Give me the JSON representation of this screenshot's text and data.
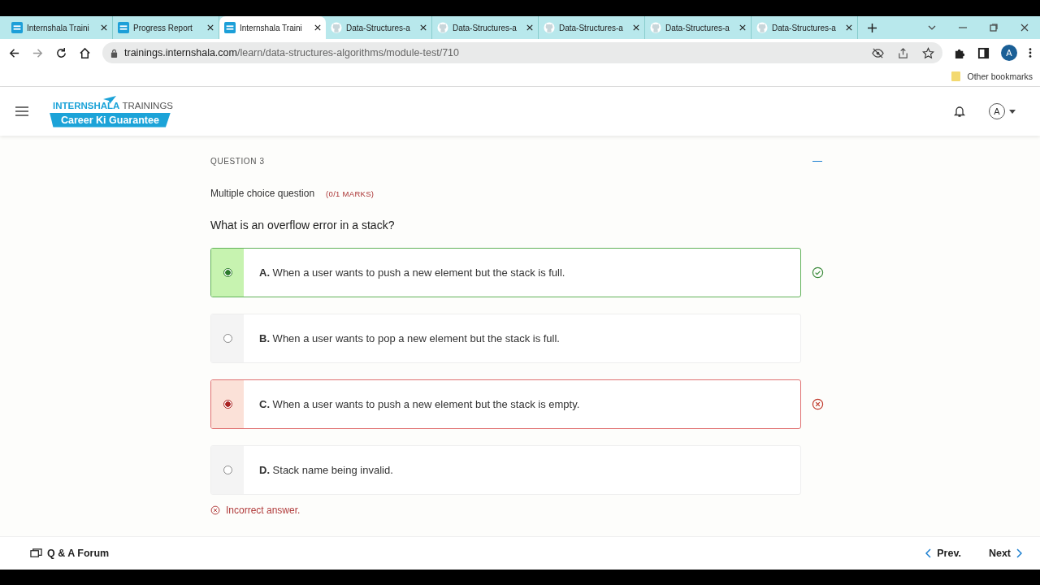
{
  "browser": {
    "tabs": [
      {
        "title": "Internshala Traini",
        "kind": "ist",
        "selected": false
      },
      {
        "title": "Progress Report",
        "kind": "ist",
        "selected": false
      },
      {
        "title": "Internshala Traini",
        "kind": "ist",
        "selected": true
      },
      {
        "title": "Data-Structures-a",
        "kind": "github",
        "selected": false
      },
      {
        "title": "Data-Structures-a",
        "kind": "github",
        "selected": false
      },
      {
        "title": "Data-Structures-a",
        "kind": "github",
        "selected": false
      },
      {
        "title": "Data-Structures-a",
        "kind": "github",
        "selected": false
      },
      {
        "title": "Data-Structures-a",
        "kind": "github",
        "selected": false
      }
    ],
    "address": {
      "host": "trainings.internshala.com",
      "path": "/learn/data-structures-algorithms/module-test/710"
    },
    "profile": "A",
    "bookmarks": "Other bookmarks"
  },
  "header": {
    "logo_primary": "INTERNSHALA",
    "logo_secondary": "TRAININGS",
    "tagline": "Career Ki Guarantee",
    "avatar": "A"
  },
  "question": {
    "number": "QUESTION 3",
    "type": "Multiple choice question",
    "marks": "(0/1 MARKS)",
    "text": "What is an overflow error in a stack?",
    "options": [
      {
        "letter": "A.",
        "text": "When a user wants to push a new element but the stack is full.",
        "selected": true,
        "kind": "correct"
      },
      {
        "letter": "B.",
        "text": "When a user wants to pop a new element but the stack is full.",
        "selected": false,
        "kind": "plain"
      },
      {
        "letter": "C.",
        "text": "When a user wants to push a new element but the stack is empty.",
        "selected": true,
        "kind": "wrong"
      },
      {
        "letter": "D.",
        "text": "Stack name being invalid.",
        "selected": false,
        "kind": "plain"
      }
    ],
    "feedback": "Incorrect answer."
  },
  "footer": {
    "forum": "Q & A Forum",
    "prev": "Prev.",
    "next": "Next"
  }
}
